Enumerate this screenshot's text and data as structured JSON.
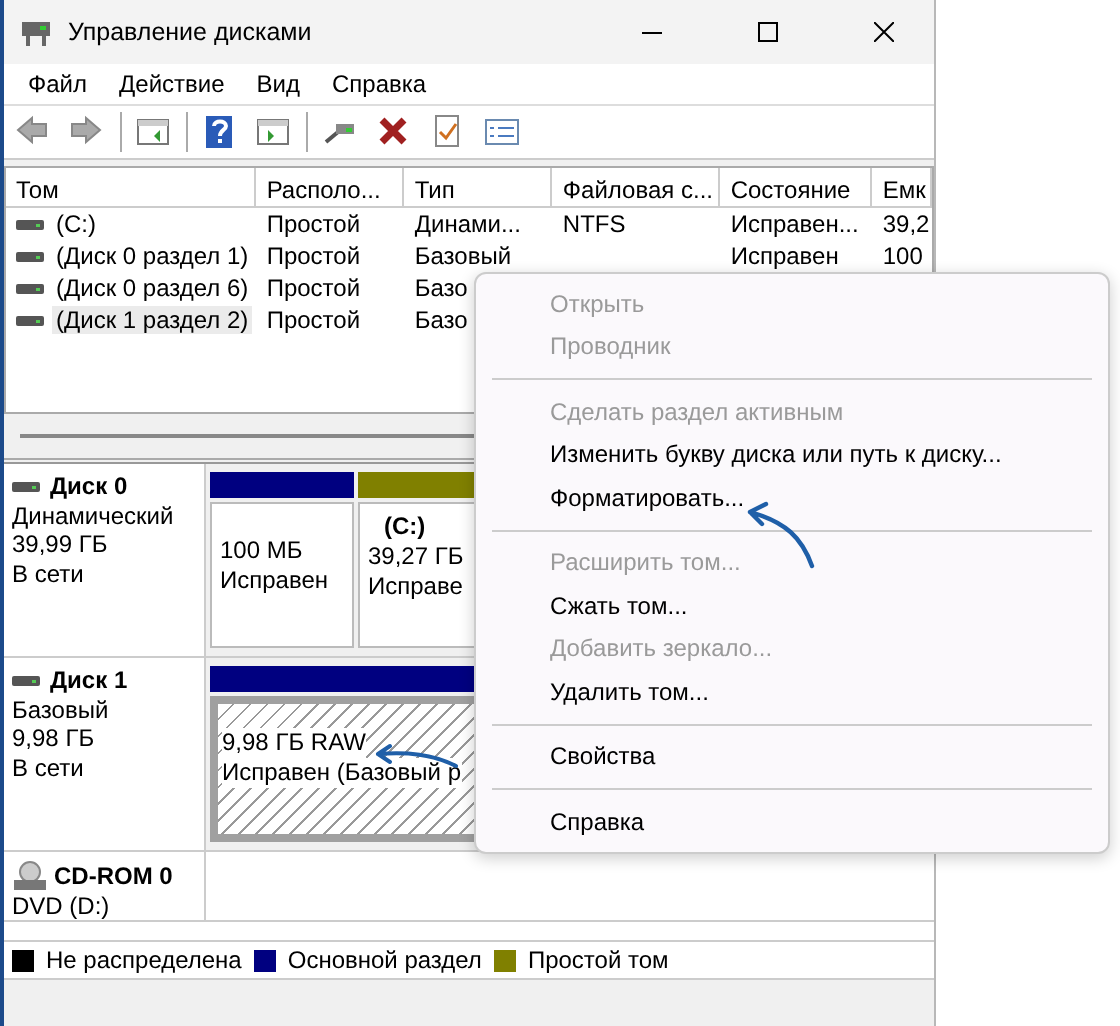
{
  "window": {
    "title": "Управление дисками"
  },
  "menu": [
    "Файл",
    "Действие",
    "Вид",
    "Справка"
  ],
  "volume_table": {
    "columns": [
      "Том",
      "Располо...",
      "Тип",
      "Файловая с...",
      "Состояние",
      "Емк"
    ],
    "rows": [
      {
        "volume": "(C:)",
        "layout": "Простой",
        "type": "Динами...",
        "fs": "NTFS",
        "status": "Исправен...",
        "capacity": "39,2",
        "selected": false
      },
      {
        "volume": "(Диск 0 раздел 1)",
        "layout": "Простой",
        "type": "Базовый",
        "status": "Исправен",
        "capacity": "100",
        "selected": false
      },
      {
        "volume": "(Диск 0 раздел 6)",
        "layout": "Простой",
        "type": "Базо",
        "selected": false
      },
      {
        "volume": "(Диск 1 раздел 2)",
        "layout": "Простой",
        "type": "Базо",
        "selected": true
      }
    ]
  },
  "disks": [
    {
      "kind": "disk",
      "name": "Диск 0",
      "type": "Динамический",
      "size": "39,99 ГБ",
      "status": "В сети",
      "partitions": [
        {
          "size": "100 МБ",
          "status": "Исправен",
          "color": "#000080",
          "hatched": false,
          "selected": false
        },
        {
          "label": "(C:)",
          "size": "39,27 ГБ",
          "status": "Исправе",
          "color": "#808000",
          "hatched": false,
          "selected": false
        }
      ]
    },
    {
      "kind": "disk",
      "name": "Диск 1",
      "type": "Базовый",
      "size": "9,98 ГБ",
      "status": "В сети",
      "partitions": [
        {
          "size": "9,98 ГБ RAW",
          "status": "Исправен (Базовый р",
          "color": "#000080",
          "hatched": true,
          "selected": true
        }
      ]
    },
    {
      "kind": "cdrom",
      "name": "CD-ROM 0",
      "type": "DVD (D:)"
    }
  ],
  "legend": [
    {
      "label": "Не распределена",
      "color": "#000000"
    },
    {
      "label": "Основной раздел",
      "color": "#000080"
    },
    {
      "label": "Простой том",
      "color": "#808000"
    }
  ],
  "context_menu": {
    "groups": [
      [
        {
          "label": "Открыть",
          "disabled": true
        },
        {
          "label": "Проводник",
          "disabled": true
        }
      ],
      [
        {
          "label": "Сделать раздел активным",
          "disabled": true
        },
        {
          "label": "Изменить букву диска или путь к диску...",
          "disabled": false
        },
        {
          "label": "Форматировать...",
          "disabled": false
        }
      ],
      [
        {
          "label": "Расширить том...",
          "disabled": true
        },
        {
          "label": "Сжать том...",
          "disabled": false
        },
        {
          "label": "Добавить зеркало...",
          "disabled": true
        },
        {
          "label": "Удалить том...",
          "disabled": false
        }
      ],
      [
        {
          "label": "Свойства",
          "disabled": false
        }
      ],
      [
        {
          "label": "Справка",
          "disabled": false
        }
      ]
    ]
  }
}
